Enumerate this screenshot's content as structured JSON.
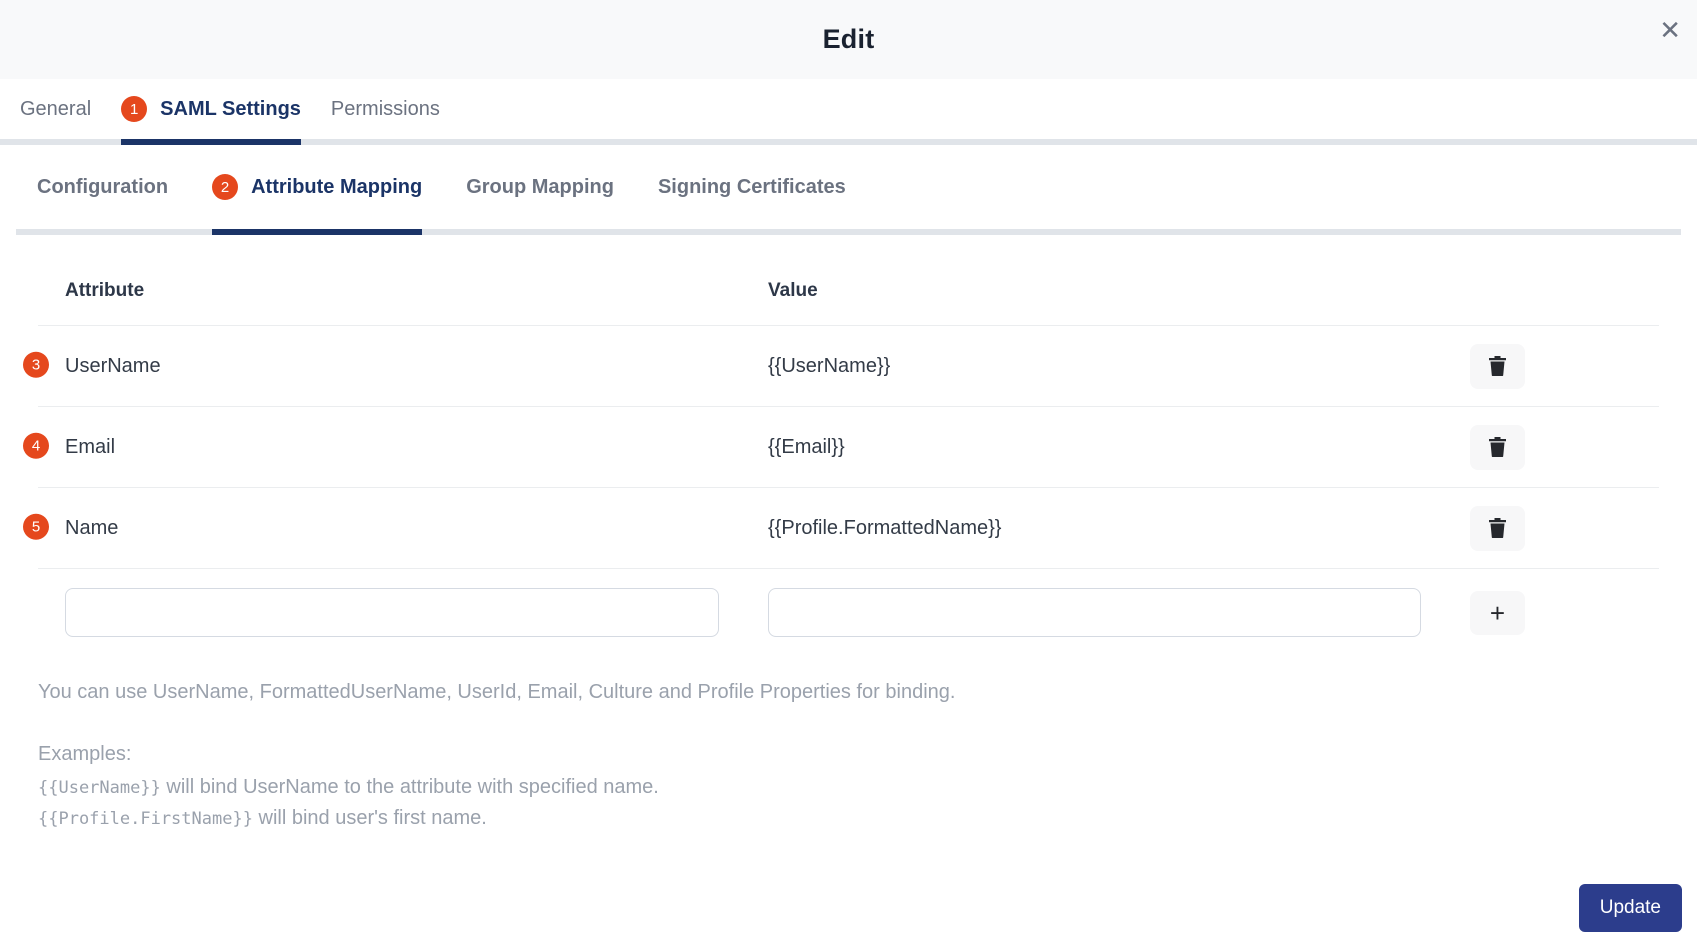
{
  "modal": {
    "title": "Edit",
    "close_glyph": "✕"
  },
  "tabs": {
    "general": "General",
    "saml_badge": "1",
    "saml": "SAML Settings",
    "permissions": "Permissions"
  },
  "subtabs": {
    "configuration": "Configuration",
    "attribute_badge": "2",
    "attribute_mapping": "Attribute Mapping",
    "group_mapping": "Group Mapping",
    "signing_certificates": "Signing Certificates"
  },
  "table": {
    "headers": {
      "attribute": "Attribute",
      "value": "Value"
    },
    "rows": [
      {
        "badge": "3",
        "attribute": "UserName",
        "value": "{{UserName}}"
      },
      {
        "badge": "4",
        "attribute": "Email",
        "value": "{{Email}}"
      },
      {
        "badge": "5",
        "attribute": "Name",
        "value": "{{Profile.FormattedName}}"
      }
    ],
    "new_row": {
      "attribute_value": "",
      "value_value": "",
      "add_glyph": "+"
    }
  },
  "help": {
    "binding_note": "You can use UserName, FormattedUserName, UserId, Email, Culture and Profile Properties for binding.",
    "examples_label": "Examples:",
    "example1_code": "{{UserName}}",
    "example1_text": " will bind UserName to the attribute with specified name.",
    "example2_code": "{{Profile.FirstName}}",
    "example2_text": " will bind user's first name."
  },
  "footer": {
    "update_label": "Update"
  },
  "colors": {
    "navy_tab": "#1b3467",
    "badge_orange": "#e5481d",
    "update_button": "#2c3d8c",
    "header_bg": "#f8f9fa",
    "track_gray": "#e0e4e9"
  }
}
